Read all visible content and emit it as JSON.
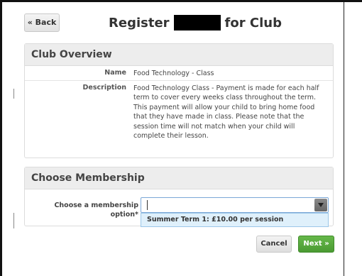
{
  "header": {
    "back_label": "« Back",
    "title_prefix": "Register",
    "title_suffix": "for Club"
  },
  "club_overview": {
    "heading": "Club Overview",
    "rows": [
      {
        "label": "Name",
        "value": "Food Technology - Class"
      },
      {
        "label": "Description",
        "value": "Food Technology Class - Payment is made for each half term to cover every weeks class throughout the term. This payment will allow your child to bring home food that they have made in class. Please note that the session time will not match when your child will complete their lesson."
      }
    ]
  },
  "membership": {
    "heading": "Choose Membership",
    "field_label": "Choose a membership option*",
    "dropdown_options": [
      "Summer Term 1: £10.00 per session"
    ]
  },
  "actions": {
    "cancel_label": "Cancel",
    "next_label": "Next »"
  }
}
